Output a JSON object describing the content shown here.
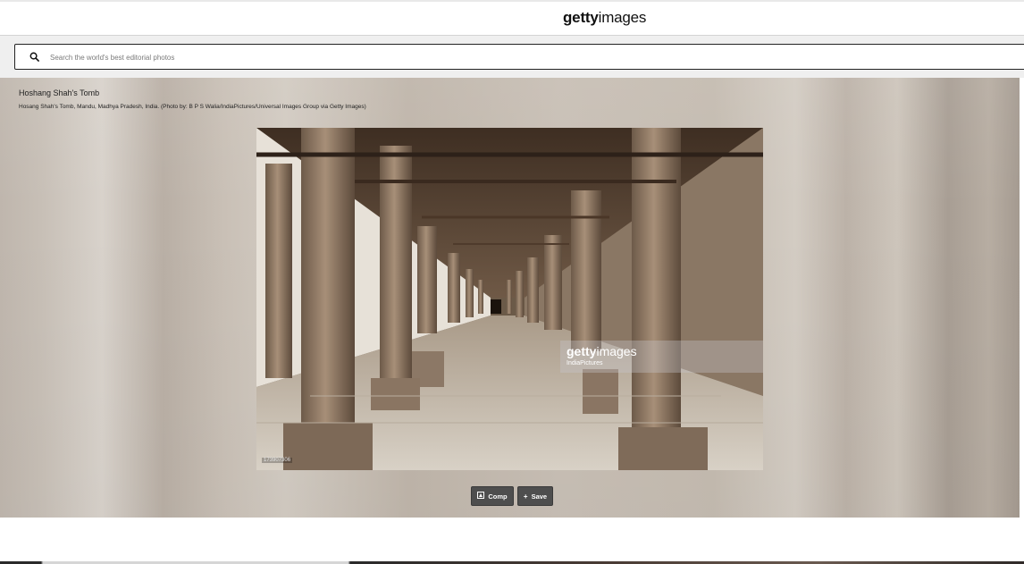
{
  "header": {
    "logo_bold": "getty",
    "logo_regular": "images"
  },
  "search": {
    "placeholder": "Search the world's best editorial photos",
    "icon": "search-icon"
  },
  "photo": {
    "title": "Hoshang Shah's Tomb",
    "caption": "Hosang Shah's Tomb, Mandu, Madhya Pradesh, India. (Photo by: B P S Walia/IndiaPictures/Universal Images Group via Getty Images)",
    "watermark_logo_bold": "getty",
    "watermark_logo_regular": "images",
    "watermark_credit": "IndiaPictures",
    "image_id": "173907306"
  },
  "actions": {
    "comp_label": "Comp",
    "comp_icon": "comp-icon",
    "save_label": "Save",
    "save_icon": "plus-icon"
  },
  "colors": {
    "button_bg": "#4e4e4e",
    "search_border": "#222222"
  }
}
